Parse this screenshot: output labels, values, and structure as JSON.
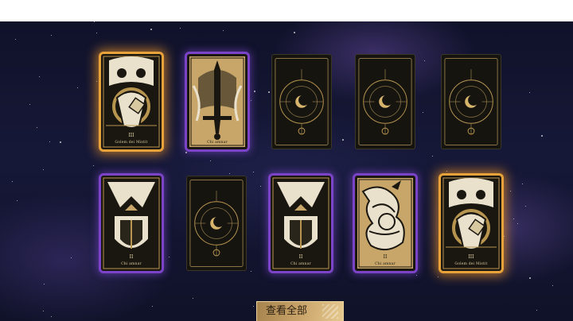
{
  "view_all_button": {
    "label": "查看全部"
  },
  "cards": [
    {
      "row": 1,
      "col": 1,
      "state": "face",
      "art": "golem",
      "frame": "gold",
      "numeral": "III",
      "caption": "Golem dei Mistit"
    },
    {
      "row": 1,
      "col": 2,
      "state": "face",
      "art": "sword",
      "frame": "purple",
      "numeral": "II",
      "caption": "Chi amnar"
    },
    {
      "row": 1,
      "col": 3,
      "state": "back",
      "frame": "none"
    },
    {
      "row": 1,
      "col": 4,
      "state": "back",
      "frame": "none"
    },
    {
      "row": 1,
      "col": 5,
      "state": "back",
      "frame": "none"
    },
    {
      "row": 2,
      "col": 1,
      "state": "face",
      "art": "shield",
      "frame": "purple",
      "numeral": "II",
      "caption": "Chi amnar"
    },
    {
      "row": 2,
      "col": 2,
      "state": "back",
      "frame": "none"
    },
    {
      "row": 2,
      "col": 3,
      "state": "face",
      "art": "shield",
      "frame": "purple",
      "numeral": "II",
      "caption": "Chi amnar"
    },
    {
      "row": 2,
      "col": 4,
      "state": "face",
      "art": "dragon",
      "frame": "purple",
      "numeral": "II",
      "caption": "Chi amnar"
    },
    {
      "row": 2,
      "col": 5,
      "state": "face",
      "art": "golem",
      "frame": "gold",
      "numeral": "III",
      "caption": "Golem dei Mistit"
    }
  ],
  "colors": {
    "gold": "#e7a23a",
    "purple": "#7b43c8",
    "card_line": "#b8954f",
    "button": "#c9a46a"
  }
}
